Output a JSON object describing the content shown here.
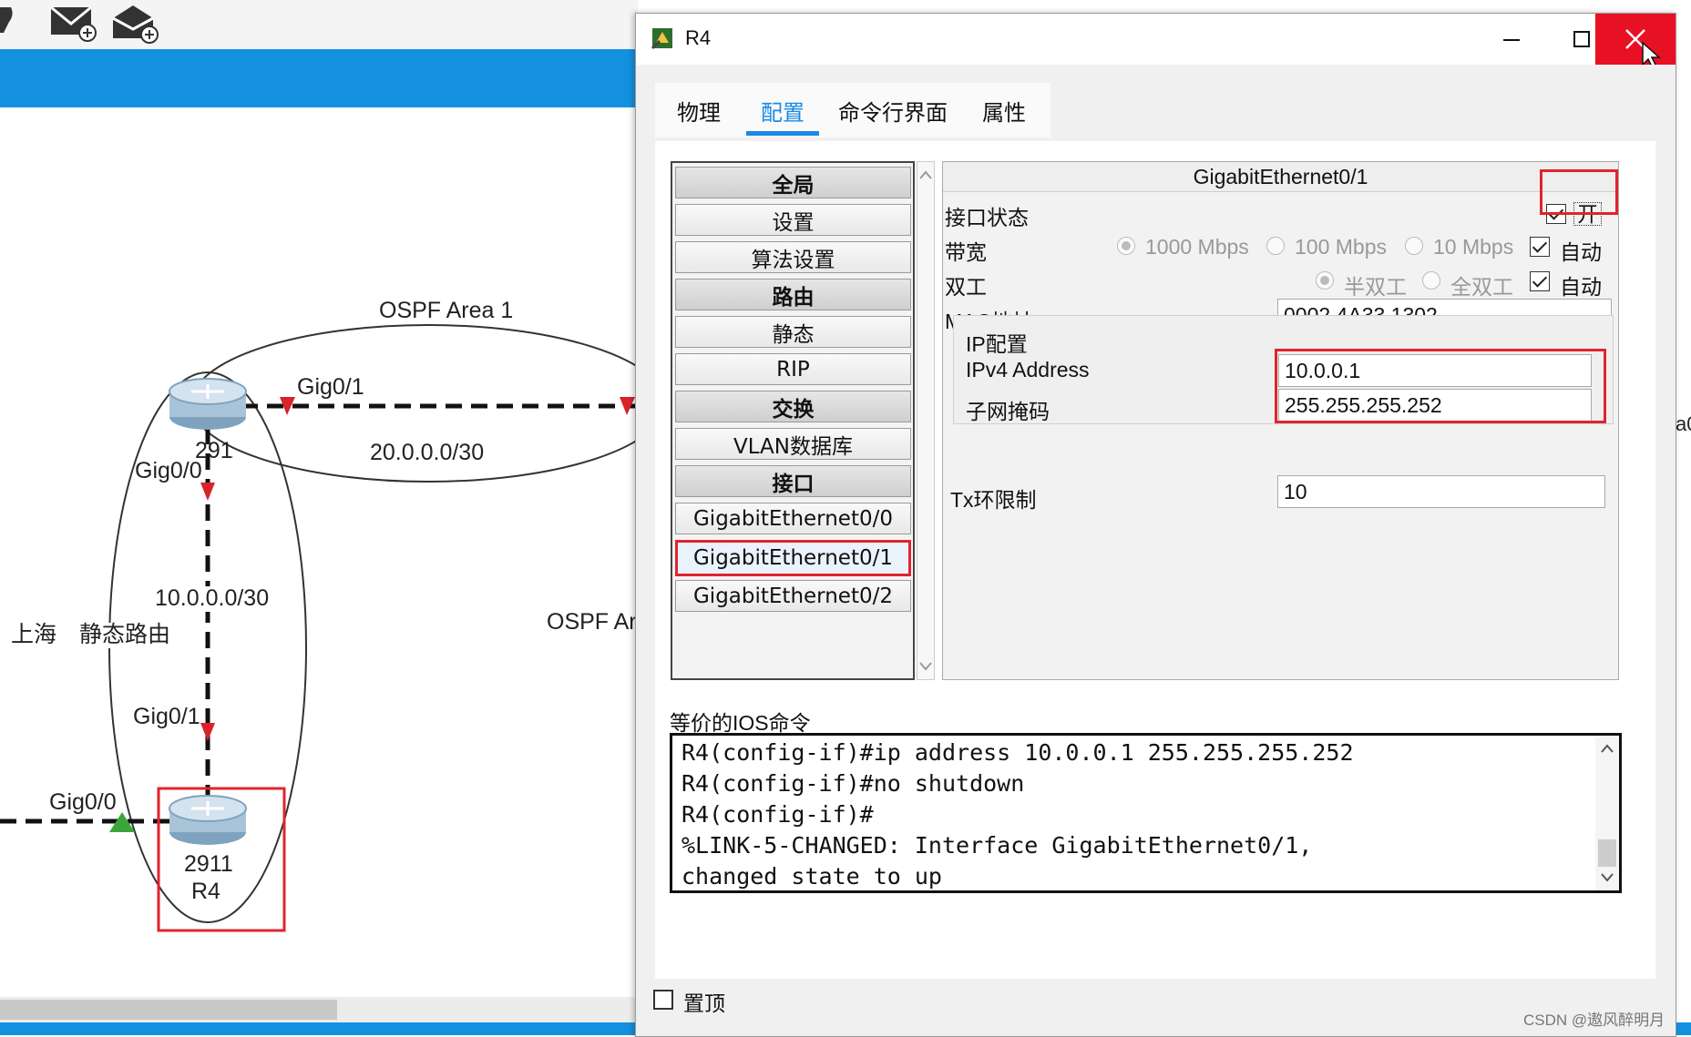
{
  "window": {
    "title": "R4"
  },
  "tabs": [
    {
      "label": "物理"
    },
    {
      "label": "配置"
    },
    {
      "label": "命令行界面"
    },
    {
      "label": "属性"
    }
  ],
  "active_tab": "配置",
  "nav": {
    "global": "全局",
    "settings": "设置",
    "algorithm": "算法设置",
    "routing": "路由",
    "static": "静态",
    "rip": "RIP",
    "switching": "交换",
    "vlan_db": "VLAN数据库",
    "interface": "接口",
    "g00": "GigabitEthernet0/0",
    "g01": "GigabitEthernet0/1",
    "g02": "GigabitEthernet0/2"
  },
  "interface": {
    "title": "GigabitEthernet0/1",
    "port_status_label": "接口状态",
    "port_on_label": "开",
    "port_on": true,
    "bandwidth_label": "带宽",
    "bw_1000": "1000 Mbps",
    "bw_100": "100 Mbps",
    "bw_10": "10 Mbps",
    "auto_label": "自动",
    "bandwidth_auto": true,
    "duplex_label": "双工",
    "half_duplex": "半双工",
    "full_duplex": "全双工",
    "duplex_auto": true,
    "mac_label": "MAC地址",
    "mac": "0002.4A33.1302",
    "ip_config_label": "IP配置",
    "ipv4_label": "IPv4 Address",
    "ipv4": "10.0.0.1",
    "mask_label": "子网掩码",
    "mask": "255.255.255.252",
    "tx_label": "Tx环限制",
    "tx": "10"
  },
  "ios": {
    "label": "等价的IOS命令",
    "lines": [
      "R4(config-if)#ip address 10.0.0.1 255.255.255.252",
      "R4(config-if)#no shutdown",
      "R4(config-if)#",
      "%LINK-5-CHANGED: Interface GigabitEthernet0/1,",
      "changed state to up"
    ]
  },
  "footer": {
    "always_on_top": "置顶",
    "watermark": "CSDN @遨风醉明月"
  },
  "topology": {
    "ospf_area1": "OSPF Area 1",
    "gig01_top": "Gig0/1",
    "net_20": "20.0.0.0/30",
    "router_top_model_fragment": "2911",
    "router_top_port_fragment": "Gig0/0",
    "net_10": "10.0.0.0/30",
    "shanghai_static": "上海　静态路由",
    "ospf_a_fragment": "OSPF Ar",
    "gig01_bottom": "Gig0/1",
    "gig00_left": "Gig0/0",
    "router_r4_model": "2911",
    "router_r4_name": "R4",
    "right_fragment": "a0"
  },
  "colors": {
    "accent": "#1a8ae6",
    "close": "#e81123",
    "highlight": "#e0242e",
    "band": "#1490e0"
  }
}
